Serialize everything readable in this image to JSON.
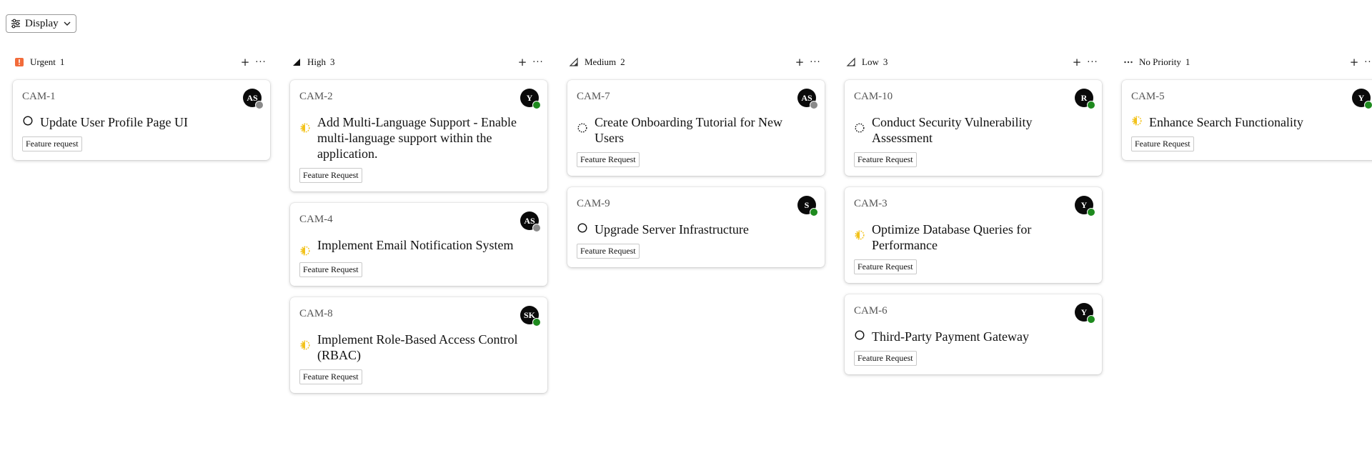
{
  "toolbar": {
    "display_label": "Display"
  },
  "colors": {
    "online": "#1e8a1e",
    "offline": "#8a8a8a",
    "urgent": "#f26b3a",
    "in_progress": "#f2c21b"
  },
  "columns": [
    {
      "title": "Urgent",
      "count": "1",
      "priority_icon": "urgent-icon",
      "cards": [
        {
          "id": "CAM-1",
          "avatar": "AS",
          "presence": "offline",
          "status": "todo",
          "title": "Update User Profile Page UI",
          "tag": "Feature request"
        }
      ]
    },
    {
      "title": "High",
      "count": "3",
      "priority_icon": "high-priority-icon",
      "cards": [
        {
          "id": "CAM-2",
          "avatar": "Y",
          "presence": "online",
          "status": "in-progress",
          "title": "Add Multi-Language Support - Enable multi-language support within the application.",
          "tag": "Feature Request"
        },
        {
          "id": "CAM-4",
          "avatar": "AS",
          "presence": "offline",
          "status": "in-progress",
          "title": "Implement Email Notification System",
          "tag": "Feature Request"
        },
        {
          "id": "CAM-8",
          "avatar": "SK",
          "presence": "online",
          "status": "in-progress",
          "title": "Implement Role-Based Access Control (RBAC)",
          "tag": "Feature Request"
        }
      ]
    },
    {
      "title": "Medium",
      "count": "2",
      "priority_icon": "medium-priority-icon",
      "cards": [
        {
          "id": "CAM-7",
          "avatar": "AS",
          "presence": "offline",
          "status": "backlog",
          "title": "Create Onboarding Tutorial for New Users",
          "tag": "Feature Request"
        },
        {
          "id": "CAM-9",
          "avatar": "S",
          "presence": "online",
          "status": "todo",
          "title": "Upgrade Server Infrastructure",
          "tag": "Feature Request"
        }
      ]
    },
    {
      "title": "Low",
      "count": "3",
      "priority_icon": "low-priority-icon",
      "cards": [
        {
          "id": "CAM-10",
          "avatar": "R",
          "presence": "online",
          "status": "backlog",
          "title": "Conduct Security Vulnerability Assessment",
          "tag": "Feature Request"
        },
        {
          "id": "CAM-3",
          "avatar": "Y",
          "presence": "online",
          "status": "in-progress",
          "title": "Optimize Database Queries for Performance",
          "tag": "Feature Request"
        },
        {
          "id": "CAM-6",
          "avatar": "Y",
          "presence": "online",
          "status": "todo",
          "title": "Third-Party Payment Gateway",
          "tag": "Feature Request"
        }
      ]
    },
    {
      "title": "No Priority",
      "count": "1",
      "priority_icon": "no-priority-icon",
      "cards": [
        {
          "id": "CAM-5",
          "avatar": "Y",
          "presence": "online",
          "status": "in-progress",
          "title": "Enhance Search Functionality",
          "tag": "Feature Request"
        }
      ]
    }
  ]
}
